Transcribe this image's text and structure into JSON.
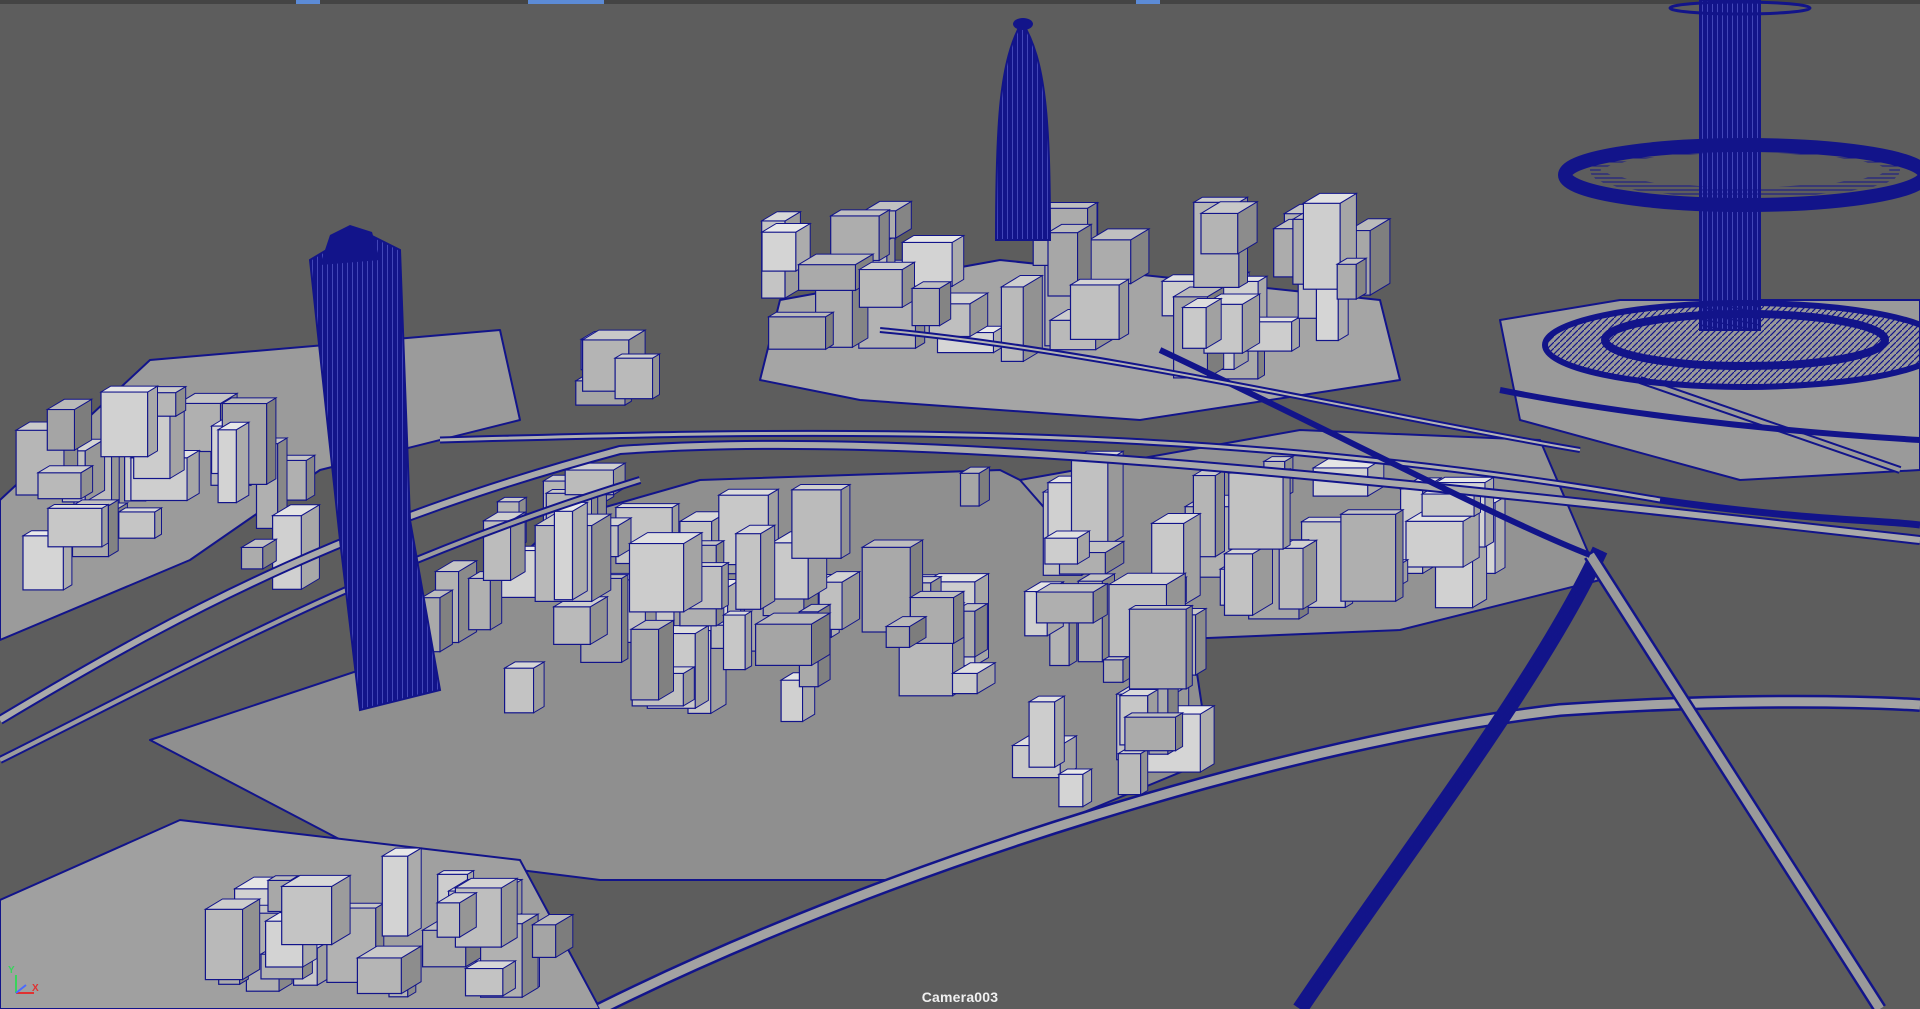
{
  "viewport": {
    "camera_label": "Camera003",
    "background_color": "#5d5d5d",
    "wire_color": "#12148a",
    "building_color": "#b8b8b8",
    "ground_color": "#8f8f8f"
  },
  "axis_gizmo": {
    "x_label": "X",
    "y_label": "Y",
    "x_color": "#e03131",
    "y_color": "#38d35b",
    "z_color": "#4a6bff"
  },
  "top_bar_marks": [
    "toolbar-mark-1",
    "toolbar-mark-2",
    "toolbar-mark-3"
  ]
}
